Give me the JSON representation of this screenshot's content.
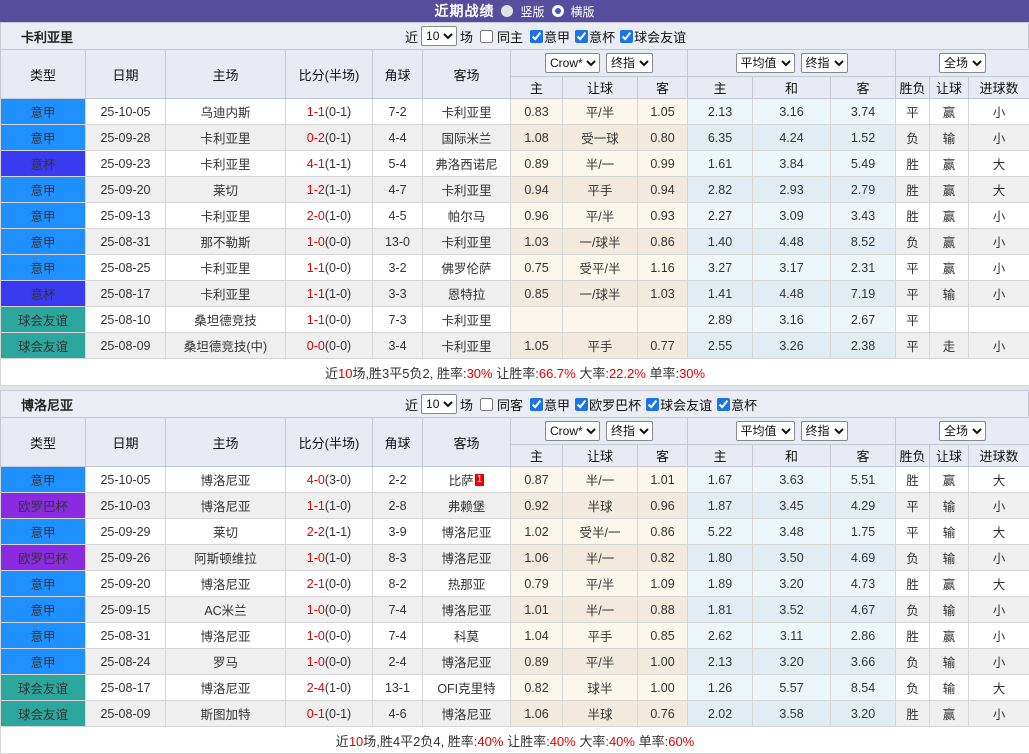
{
  "topbar": {
    "title": "近期战绩",
    "radios": [
      {
        "label": "竖版",
        "selected": false
      },
      {
        "label": "横版",
        "selected": true
      }
    ]
  },
  "type_colors": {
    "意甲": "#1E90FF",
    "意杯": "#3A3AF0",
    "球会友谊": "#2BA79E",
    "欧罗巴杯": "#8A2BE2"
  },
  "flag_colors": {
    "red": "#E60000",
    "green": "#009933",
    "blue": "#2A2AD6"
  },
  "filter_labels": {
    "near": "近",
    "games": "场"
  },
  "dropdowns": {
    "odds_source": "Crow*",
    "odds_period": "终指",
    "avg_source": "平均值",
    "avg_period": "终指",
    "scope": "全场"
  },
  "columns": {
    "type": "类型",
    "date": "日期",
    "home": "主场",
    "score": "比分(半场)",
    "corner": "角球",
    "away": "客场",
    "odds_home": "主",
    "odds_handicap": "让球",
    "odds_away": "客",
    "avg_home": "主",
    "avg_draw": "和",
    "avg_away": "客",
    "result": "胜负",
    "handicap": "让球",
    "goals": "进球数"
  },
  "tables": [
    {
      "team": "卡利亚里",
      "near_count": "10",
      "same_label": "同主",
      "same_checked": false,
      "leagues": [
        {
          "label": "意甲",
          "checked": true
        },
        {
          "label": "意杯",
          "checked": true
        },
        {
          "label": "球会友谊",
          "checked": true
        }
      ],
      "rows": [
        {
          "type": "意甲",
          "date": "25-10-05",
          "home": "乌迪内斯",
          "home_team": false,
          "home_card": "",
          "ft": "1-1",
          "ht": "(0-1)",
          "corner": "7-2",
          "away": "卡利亚里",
          "away_team": true,
          "away_card": "",
          "odds": [
            "0.83",
            "平/半",
            "1.05"
          ],
          "avg": [
            "2.13",
            "3.16",
            "3.74"
          ],
          "result": {
            "t": "平",
            "c": "green"
          },
          "handicap": {
            "t": "赢",
            "c": "red"
          },
          "goals": {
            "t": "小",
            "c": "blue"
          }
        },
        {
          "type": "意甲",
          "date": "25-09-28",
          "home": "卡利亚里",
          "home_team": true,
          "home_card": "",
          "ft": "0-2",
          "ht": "(0-1)",
          "corner": "4-4",
          "away": "国际米兰",
          "away_team": false,
          "away_card": "",
          "odds": [
            "1.08",
            "受一球",
            "0.80"
          ],
          "avg": [
            "6.35",
            "4.24",
            "1.52"
          ],
          "result": {
            "t": "负",
            "c": "blue"
          },
          "handicap": {
            "t": "输",
            "c": "blue"
          },
          "goals": {
            "t": "小",
            "c": "blue"
          }
        },
        {
          "type": "意杯",
          "date": "25-09-23",
          "home": "卡利亚里",
          "home_team": true,
          "home_card": "",
          "ft": "4-1",
          "ht": "(1-1)",
          "corner": "5-4",
          "away": "弗洛西诺尼",
          "away_team": false,
          "away_card": "",
          "odds": [
            "0.89",
            "半/一",
            "0.99"
          ],
          "avg": [
            "1.61",
            "3.84",
            "5.49"
          ],
          "result": {
            "t": "胜",
            "c": "red"
          },
          "handicap": {
            "t": "赢",
            "c": "red"
          },
          "goals": {
            "t": "大",
            "c": "red"
          }
        },
        {
          "type": "意甲",
          "date": "25-09-20",
          "home": "莱切",
          "home_team": false,
          "home_card": "",
          "ft": "1-2",
          "ht": "(1-1)",
          "corner": "4-7",
          "away": "卡利亚里",
          "away_team": true,
          "away_card": "",
          "odds": [
            "0.94",
            "平手",
            "0.94"
          ],
          "avg": [
            "2.82",
            "2.93",
            "2.79"
          ],
          "result": {
            "t": "胜",
            "c": "red"
          },
          "handicap": {
            "t": "赢",
            "c": "red"
          },
          "goals": {
            "t": "大",
            "c": "red"
          }
        },
        {
          "type": "意甲",
          "date": "25-09-13",
          "home": "卡利亚里",
          "home_team": true,
          "home_card": "",
          "ft": "2-0",
          "ht": "(1-0)",
          "corner": "4-5",
          "away": "帕尔马",
          "away_team": false,
          "away_card": "",
          "odds": [
            "0.96",
            "平/半",
            "0.93"
          ],
          "avg": [
            "2.27",
            "3.09",
            "3.43"
          ],
          "result": {
            "t": "胜",
            "c": "red"
          },
          "handicap": {
            "t": "赢",
            "c": "red"
          },
          "goals": {
            "t": "小",
            "c": "blue"
          }
        },
        {
          "type": "意甲",
          "date": "25-08-31",
          "home": "那不勒斯",
          "home_team": false,
          "home_card": "",
          "ft": "1-0",
          "ht": "(0-0)",
          "corner": "13-0",
          "away": "卡利亚里",
          "away_team": true,
          "away_card": "",
          "odds": [
            "1.03",
            "一/球半",
            "0.86"
          ],
          "avg": [
            "1.40",
            "4.48",
            "8.52"
          ],
          "result": {
            "t": "负",
            "c": "blue"
          },
          "handicap": {
            "t": "赢",
            "c": "red"
          },
          "goals": {
            "t": "小",
            "c": "blue"
          }
        },
        {
          "type": "意甲",
          "date": "25-08-25",
          "home": "卡利亚里",
          "home_team": true,
          "home_card": "",
          "ft": "1-1",
          "ht": "(0-0)",
          "corner": "3-2",
          "away": "佛罗伦萨",
          "away_team": false,
          "away_card": "",
          "odds": [
            "0.75",
            "受平/半",
            "1.16"
          ],
          "avg": [
            "3.27",
            "3.17",
            "2.31"
          ],
          "result": {
            "t": "平",
            "c": "green"
          },
          "handicap": {
            "t": "赢",
            "c": "red"
          },
          "goals": {
            "t": "小",
            "c": "blue"
          }
        },
        {
          "type": "意杯",
          "date": "25-08-17",
          "home": "卡利亚里",
          "home_team": true,
          "home_card": "",
          "ft": "1-1",
          "ht": "(1-0)",
          "corner": "3-3",
          "away": "恩特拉",
          "away_team": false,
          "away_card": "",
          "odds": [
            "0.85",
            "一/球半",
            "1.03"
          ],
          "avg": [
            "1.41",
            "4.48",
            "7.19"
          ],
          "result": {
            "t": "平",
            "c": "green"
          },
          "handicap": {
            "t": "输",
            "c": "blue"
          },
          "goals": {
            "t": "小",
            "c": "blue"
          }
        },
        {
          "type": "球会友谊",
          "date": "25-08-10",
          "home": "桑坦德竞技",
          "home_team": false,
          "home_card": "",
          "ft": "1-1",
          "ht": "(0-0)",
          "corner": "7-3",
          "away": "卡利亚里",
          "away_team": true,
          "away_card": "",
          "odds": [
            "",
            "",
            ""
          ],
          "avg": [
            "2.89",
            "3.16",
            "2.67"
          ],
          "result": {
            "t": "平",
            "c": "green"
          },
          "handicap": {
            "t": "",
            "c": "blue"
          },
          "goals": {
            "t": "",
            "c": "blue"
          }
        },
        {
          "type": "球会友谊",
          "date": "25-08-09",
          "home": "桑坦德竞技(中)",
          "home_team": false,
          "home_card": "",
          "ft": "0-0",
          "ht": "(0-0)",
          "corner": "3-4",
          "away": "卡利亚里",
          "away_team": true,
          "away_card": "",
          "odds": [
            "1.05",
            "平手",
            "0.77"
          ],
          "avg": [
            "2.55",
            "3.26",
            "2.38"
          ],
          "result": {
            "t": "平",
            "c": "green"
          },
          "handicap": {
            "t": "走",
            "c": "green"
          },
          "goals": {
            "t": "小",
            "c": "blue"
          }
        }
      ],
      "summary": [
        {
          "t": "近",
          "c": "k"
        },
        {
          "t": "10",
          "c": "r"
        },
        {
          "t": "场,胜3平5负2, 胜率:",
          "c": "k"
        },
        {
          "t": "30%",
          "c": "r"
        },
        {
          "t": " 让胜率:",
          "c": "k"
        },
        {
          "t": "66.7%",
          "c": "r"
        },
        {
          "t": " 大率:",
          "c": "k"
        },
        {
          "t": "22.2%",
          "c": "r"
        },
        {
          "t": " 单率:",
          "c": "k"
        },
        {
          "t": "30%",
          "c": "r"
        }
      ]
    },
    {
      "team": "博洛尼亚",
      "near_count": "10",
      "same_label": "同客",
      "same_checked": false,
      "leagues": [
        {
          "label": "意甲",
          "checked": true
        },
        {
          "label": "欧罗巴杯",
          "checked": true
        },
        {
          "label": "球会友谊",
          "checked": true
        },
        {
          "label": "意杯",
          "checked": true
        }
      ],
      "rows": [
        {
          "type": "意甲",
          "date": "25-10-05",
          "home": "博洛尼亚",
          "home_team": true,
          "home_card": "",
          "ft": "4-0",
          "ht": "(3-0)",
          "corner": "2-2",
          "away": "比萨",
          "away_team": false,
          "away_card": "1",
          "odds": [
            "0.87",
            "半/一",
            "1.01"
          ],
          "avg": [
            "1.67",
            "3.63",
            "5.51"
          ],
          "result": {
            "t": "胜",
            "c": "red"
          },
          "handicap": {
            "t": "赢",
            "c": "red"
          },
          "goals": {
            "t": "大",
            "c": "red"
          }
        },
        {
          "type": "欧罗巴杯",
          "date": "25-10-03",
          "home": "博洛尼亚",
          "home_team": true,
          "home_card": "",
          "ft": "1-1",
          "ht": "(1-0)",
          "corner": "2-8",
          "away": "弗赖堡",
          "away_team": false,
          "away_card": "",
          "odds": [
            "0.92",
            "半球",
            "0.96"
          ],
          "avg": [
            "1.87",
            "3.45",
            "4.29"
          ],
          "result": {
            "t": "平",
            "c": "green"
          },
          "handicap": {
            "t": "输",
            "c": "blue"
          },
          "goals": {
            "t": "小",
            "c": "blue"
          }
        },
        {
          "type": "意甲",
          "date": "25-09-29",
          "home": "莱切",
          "home_team": false,
          "home_card": "",
          "ft": "2-2",
          "ht": "(1-1)",
          "corner": "3-9",
          "away": "博洛尼亚",
          "away_team": true,
          "away_card": "",
          "odds": [
            "1.02",
            "受半/一",
            "0.86"
          ],
          "avg": [
            "5.22",
            "3.48",
            "1.75"
          ],
          "result": {
            "t": "平",
            "c": "green"
          },
          "handicap": {
            "t": "输",
            "c": "blue"
          },
          "goals": {
            "t": "大",
            "c": "red"
          }
        },
        {
          "type": "欧罗巴杯",
          "date": "25-09-26",
          "home": "阿斯顿维拉",
          "home_team": false,
          "home_card": "",
          "ft": "1-0",
          "ht": "(1-0)",
          "corner": "8-3",
          "away": "博洛尼亚",
          "away_team": true,
          "away_card": "",
          "odds": [
            "1.06",
            "半/一",
            "0.82"
          ],
          "avg": [
            "1.80",
            "3.50",
            "4.69"
          ],
          "result": {
            "t": "负",
            "c": "blue"
          },
          "handicap": {
            "t": "输",
            "c": "blue"
          },
          "goals": {
            "t": "小",
            "c": "blue"
          }
        },
        {
          "type": "意甲",
          "date": "25-09-20",
          "home": "博洛尼亚",
          "home_team": true,
          "home_card": "",
          "ft": "2-1",
          "ht": "(0-0)",
          "corner": "8-2",
          "away": "热那亚",
          "away_team": false,
          "away_card": "",
          "odds": [
            "0.79",
            "平/半",
            "1.09"
          ],
          "avg": [
            "1.89",
            "3.20",
            "4.73"
          ],
          "result": {
            "t": "胜",
            "c": "red"
          },
          "handicap": {
            "t": "赢",
            "c": "red"
          },
          "goals": {
            "t": "大",
            "c": "red"
          }
        },
        {
          "type": "意甲",
          "date": "25-09-15",
          "home": "AC米兰",
          "home_team": false,
          "home_card": "",
          "ft": "1-0",
          "ht": "(0-0)",
          "corner": "7-4",
          "away": "博洛尼亚",
          "away_team": true,
          "away_card": "",
          "odds": [
            "1.01",
            "半/一",
            "0.88"
          ],
          "avg": [
            "1.81",
            "3.52",
            "4.67"
          ],
          "result": {
            "t": "负",
            "c": "blue"
          },
          "handicap": {
            "t": "输",
            "c": "blue"
          },
          "goals": {
            "t": "小",
            "c": "blue"
          }
        },
        {
          "type": "意甲",
          "date": "25-08-31",
          "home": "博洛尼亚",
          "home_team": true,
          "home_card": "",
          "ft": "1-0",
          "ht": "(0-0)",
          "corner": "7-4",
          "away": "科莫",
          "away_team": false,
          "away_card": "",
          "odds": [
            "1.04",
            "平手",
            "0.85"
          ],
          "avg": [
            "2.62",
            "3.11",
            "2.86"
          ],
          "result": {
            "t": "胜",
            "c": "red"
          },
          "handicap": {
            "t": "赢",
            "c": "red"
          },
          "goals": {
            "t": "小",
            "c": "blue"
          }
        },
        {
          "type": "意甲",
          "date": "25-08-24",
          "home": "罗马",
          "home_team": false,
          "home_card": "",
          "ft": "1-0",
          "ht": "(0-0)",
          "corner": "2-4",
          "away": "博洛尼亚",
          "away_team": true,
          "away_card": "",
          "odds": [
            "0.89",
            "平/半",
            "1.00"
          ],
          "avg": [
            "2.13",
            "3.20",
            "3.66"
          ],
          "result": {
            "t": "负",
            "c": "blue"
          },
          "handicap": {
            "t": "输",
            "c": "blue"
          },
          "goals": {
            "t": "小",
            "c": "blue"
          }
        },
        {
          "type": "球会友谊",
          "date": "25-08-17",
          "home": "博洛尼亚",
          "home_team": true,
          "home_card": "",
          "ft": "2-4",
          "ht": "(1-0)",
          "corner": "13-1",
          "away": "OFI克里特",
          "away_team": false,
          "away_card": "",
          "odds": [
            "0.82",
            "球半",
            "1.00"
          ],
          "avg": [
            "1.26",
            "5.57",
            "8.54"
          ],
          "result": {
            "t": "负",
            "c": "blue"
          },
          "handicap": {
            "t": "输",
            "c": "blue"
          },
          "goals": {
            "t": "大",
            "c": "red"
          }
        },
        {
          "type": "球会友谊",
          "date": "25-08-09",
          "home": "斯图加特",
          "home_team": false,
          "home_card": "",
          "ft": "0-1",
          "ht": "(0-1)",
          "corner": "4-6",
          "away": "博洛尼亚",
          "away_team": true,
          "away_card": "",
          "odds": [
            "1.06",
            "半球",
            "0.76"
          ],
          "avg": [
            "2.02",
            "3.58",
            "3.20"
          ],
          "result": {
            "t": "胜",
            "c": "red"
          },
          "handicap": {
            "t": "赢",
            "c": "red"
          },
          "goals": {
            "t": "小",
            "c": "blue"
          }
        }
      ],
      "summary": [
        {
          "t": "近",
          "c": "k"
        },
        {
          "t": "10",
          "c": "r"
        },
        {
          "t": "场,胜4平2负4, 胜率:",
          "c": "k"
        },
        {
          "t": "40%",
          "c": "r"
        },
        {
          "t": " 让胜率:",
          "c": "k"
        },
        {
          "t": "40%",
          "c": "r"
        },
        {
          "t": " 大率:",
          "c": "k"
        },
        {
          "t": "40%",
          "c": "r"
        },
        {
          "t": " 单率:",
          "c": "k"
        },
        {
          "t": "60%",
          "c": "r"
        }
      ]
    }
  ]
}
